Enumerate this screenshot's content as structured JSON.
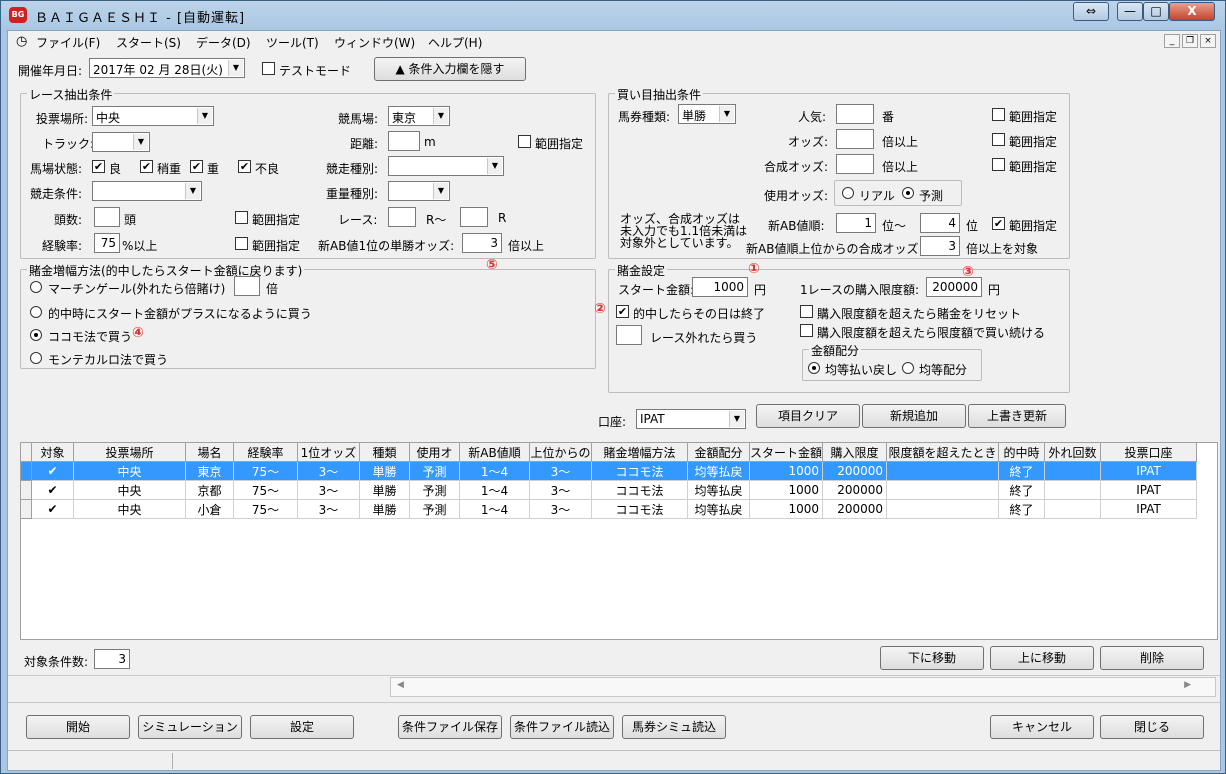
{
  "window": {
    "title": "ＢＡＩＧＡＥＳＨＩ - [自動運転]",
    "icon_label": "BG",
    "caption_buttons": [
      "⇔",
      "—",
      "□",
      "X"
    ]
  },
  "menu": {
    "items": [
      "ファイル(F)",
      "スタート(S)",
      "データ(D)",
      "ツール(T)",
      "ウィンドウ(W)",
      "ヘルプ(H)"
    ]
  },
  "toolbar": {
    "date_label": "開催年月日:",
    "date_value": "2017年 02 月 28日(火)",
    "test_mode_label": "テストモード",
    "test_mode_checked": false,
    "hide_button": "▲ 条件入力欄を隠す"
  },
  "race_conditions": {
    "title": "レース抽出条件",
    "venue_label": "投票場所:",
    "venue_value": "中央",
    "track_label": "トラック:",
    "track_value": "",
    "condition_label": "馬場状態:",
    "condition_options": [
      {
        "label": "良",
        "checked": true
      },
      {
        "label": "稍重",
        "checked": true
      },
      {
        "label": "重",
        "checked": true
      },
      {
        "label": "不良",
        "checked": true
      }
    ],
    "race_condition_label": "競走条件:",
    "race_condition_value": "",
    "heads_label": "頭数:",
    "heads_value": "",
    "heads_unit": "頭",
    "range1_label": "範囲指定",
    "experience_label": "経験率:",
    "experience_value": "75",
    "experience_unit": "%以上",
    "range2_label": "範囲指定",
    "racecourse_label": "競馬場:",
    "racecourse_value": "東京",
    "distance_label": "距離:",
    "distance_value": "",
    "distance_unit": "m",
    "distance_range_label": "範囲指定",
    "race_type_label": "競走種別:",
    "race_type_value": "",
    "weight_label": "重量種別:",
    "weight_value": "",
    "race_label": "レース:",
    "race_from": "",
    "race_mid": "R〜",
    "race_to": "",
    "race_unit": "R",
    "ab_odds_label": "新AB値1位の単勝オッズ:",
    "ab_odds_value": "3",
    "ab_odds_unit": "倍以上"
  },
  "bet_conditions": {
    "title": "買い目抽出条件",
    "ticket_label": "馬券種類:",
    "ticket_value": "単勝",
    "popularity_label": "人気:",
    "popularity_value": "",
    "popularity_unit": "番",
    "odds_label": "オッズ:",
    "odds_value": "",
    "odds_unit": "倍以上",
    "combo_odds_label": "合成オッズ:",
    "combo_odds_value": "",
    "combo_odds_unit": "倍以上",
    "range_label": "範囲指定",
    "use_odds_label": "使用オッズ:",
    "use_odds_real": "リアル",
    "use_odds_forecast": "予測",
    "note": "オッズ、合成オッズは\n未入力でも1.1倍未満は\n対象外としています。",
    "ab_rank_label": "新AB値順:",
    "ab_rank_from": "1",
    "ab_rank_mid": "位〜",
    "ab_rank_to": "4",
    "ab_rank_unit": "位",
    "ab_rank_range": "範囲指定",
    "ab_rank_range_checked": true,
    "ab_combo_label": "新AB値順上位からの合成オッズ",
    "ab_combo_value": "3",
    "ab_combo_unit": "倍以上を対象"
  },
  "stake_method": {
    "title": "賭金増幅方法(的中したらスタート金額に戻ります)",
    "options": [
      {
        "label": "マーチンゲール(外れたら倍賭け)",
        "selected": false
      },
      {
        "label": "的中時にスタート金額がプラスになるように買う",
        "selected": false
      },
      {
        "label": "ココモ法で買う",
        "selected": true
      },
      {
        "label": "モンテカルロ法で買う",
        "selected": false
      }
    ],
    "multiplier_value": "",
    "multiplier_unit": "倍"
  },
  "stake_settings": {
    "title": "賭金設定",
    "start_label": "スタート金額:",
    "start_value": "1000",
    "start_unit": "円",
    "limit_label": "1レースの購入限度額:",
    "limit_value": "200000",
    "limit_unit": "円",
    "stop_on_hit": "的中したらその日は終了",
    "stop_on_hit_checked": true,
    "lose_value": "",
    "lose_label": "レース外れたら買う",
    "reset_label": "購入限度額を超えたら賭金をリセット",
    "continue_label": "購入限度額を超えたら限度額で買い続ける",
    "dist_title": "金額配分",
    "dist_equal_payback": "均等払い戻し",
    "dist_equal": "均等配分"
  },
  "annotations": [
    "①",
    "②",
    "③",
    "④",
    "⑤"
  ],
  "account": {
    "label": "口座:",
    "value": "IPAT",
    "clear_button": "項目クリア",
    "add_button": "新規追加",
    "overwrite_button": "上書き更新"
  },
  "table": {
    "columns": [
      "対象",
      "投票場所",
      "場名",
      "経験率",
      "1位オッズ",
      "種類",
      "使用オ",
      "新AB値順",
      "上位からの",
      "賭金増幅方法",
      "金額配分",
      "スタート金額",
      "購入限度",
      "限度額を超えたとき",
      "的中時",
      "外れ回数",
      "投票口座"
    ],
    "rows": [
      [
        "✔",
        "中央",
        "東京",
        "75〜",
        "3〜",
        "単勝",
        "予測",
        "1〜4",
        "3〜",
        "ココモ法",
        "均等払戻",
        "1000",
        "200000",
        "",
        "終了",
        "",
        "IPAT"
      ],
      [
        "✔",
        "中央",
        "京都",
        "75〜",
        "3〜",
        "単勝",
        "予測",
        "1〜4",
        "3〜",
        "ココモ法",
        "均等払戻",
        "1000",
        "200000",
        "",
        "終了",
        "",
        "IPAT"
      ],
      [
        "✔",
        "中央",
        "小倉",
        "75〜",
        "3〜",
        "単勝",
        "予測",
        "1〜4",
        "3〜",
        "ココモ法",
        "均等払戻",
        "1000",
        "200000",
        "",
        "終了",
        "",
        "IPAT"
      ]
    ],
    "selected_row": 0
  },
  "footer": {
    "count_label": "対象条件数:",
    "count_value": "3",
    "move_down": "下に移動",
    "move_up": "上に移動",
    "delete": "削除",
    "start": "開始",
    "simulation": "シミュレーション",
    "settings": "設定",
    "save_file": "条件ファイル保存",
    "load_file": "条件ファイル読込",
    "ticket_sim": "馬券シミュ読込",
    "cancel": "キャンセル",
    "close": "閉じる"
  }
}
